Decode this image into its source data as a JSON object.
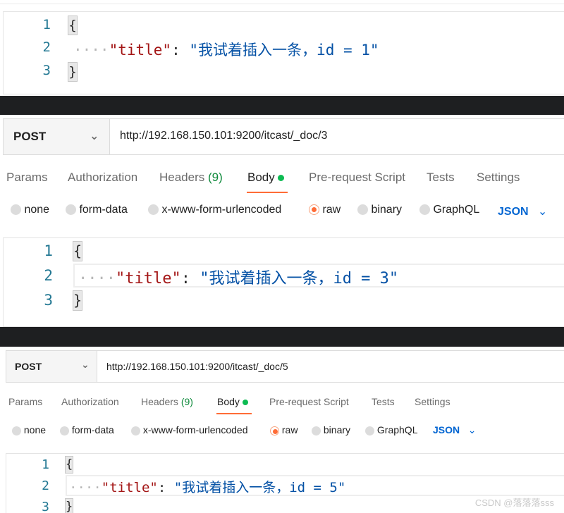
{
  "panes": [
    {
      "lines": [
        "1",
        "2",
        "3"
      ],
      "open": "{",
      "close": "}",
      "dots": "····",
      "key": "\"title\"",
      "colon": ":",
      "value": "\"我试着插入一条，id = 1\""
    },
    {
      "lines": [
        "1",
        "2",
        "3"
      ],
      "open": "{",
      "close": "}",
      "dots": "····",
      "key": "\"title\"",
      "colon": ":",
      "value": "\"我试着插入一条，id = 3\""
    },
    {
      "lines": [
        "1",
        "2",
        "3"
      ],
      "open": "{",
      "close": "}",
      "dots": "····",
      "key": "\"title\"",
      "colon": ":",
      "value": "\"我试着插入一条，id = 5\""
    }
  ],
  "requests": [
    {
      "method": "POST",
      "url": "http://192.168.150.101:9200/itcast/_doc/3",
      "tabs": {
        "params": "Params",
        "authorization": "Authorization",
        "headers": "Headers",
        "headers_count": "(9)",
        "body": "Body",
        "prerequest": "Pre-request Script",
        "tests": "Tests",
        "settings": "Settings"
      },
      "body_types": {
        "none": "none",
        "form_data": "form-data",
        "urlencoded": "x-www-form-urlencoded",
        "raw": "raw",
        "binary": "binary",
        "graphql": "GraphQL"
      },
      "format": "JSON"
    },
    {
      "method": "POST",
      "url": "http://192.168.150.101:9200/itcast/_doc/5",
      "tabs": {
        "params": "Params",
        "authorization": "Authorization",
        "headers": "Headers",
        "headers_count": "(9)",
        "body": "Body",
        "prerequest": "Pre-request Script",
        "tests": "Tests",
        "settings": "Settings"
      },
      "body_types": {
        "none": "none",
        "form_data": "form-data",
        "urlencoded": "x-www-form-urlencoded",
        "raw": "raw",
        "binary": "binary",
        "graphql": "GraphQL"
      },
      "format": "JSON"
    }
  ],
  "watermark": "CSDN @落落落sss",
  "colors": {
    "accent": "#ff6c37",
    "active_dot": "#0cbb52",
    "json_link": "#0265d2",
    "separator": "#1e1f21"
  }
}
